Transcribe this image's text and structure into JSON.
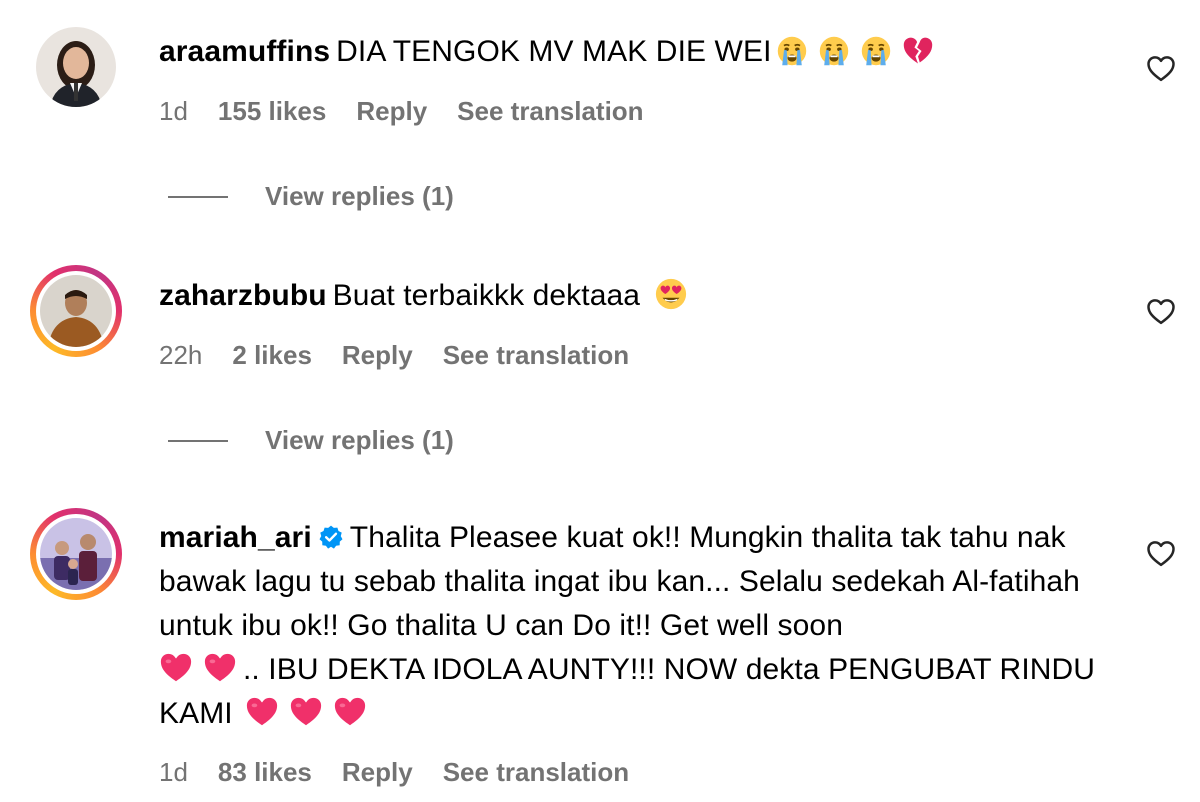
{
  "comments": [
    {
      "username": "araamuffins",
      "text": "DIA TENGOK MV MAK DIE WEI",
      "time": "1d",
      "likes": "155 likes",
      "reply": "Reply",
      "translation": "See translation",
      "view_replies": "View replies (1)",
      "emojis": [
        "crying-face",
        "crying-face",
        "crying-face",
        "broken-heart"
      ]
    },
    {
      "username": "zaharzbubu",
      "text": "Buat terbaikkk dektaaa",
      "time": "22h",
      "likes": "2 likes",
      "reply": "Reply",
      "translation": "See translation",
      "view_replies": "View replies (1)",
      "emojis": [
        "heart-eyes-face"
      ]
    },
    {
      "username": "mariah_ari",
      "verified": true,
      "text_part1": "Thalita Pleasee kuat ok!! Mungkin thalita tak tahu nak bawak lagu tu sebab thalita ingat ibu kan... Selalu sedekah Al-fatihah untuk ibu ok!! Go thalita U can Do it!! Get well soon",
      "text_part2": ".. IBU DEKTA IDOLA AUNTY!!! NOW dekta PENGUBAT RINDU KAMI",
      "time": "1d",
      "likes": "83 likes",
      "reply": "Reply",
      "translation": "See translation",
      "emojis": [
        "pink-heart",
        "pink-heart",
        "pink-heart",
        "pink-heart",
        "pink-heart"
      ]
    }
  ],
  "colors": {
    "meta_gray": "#737373",
    "verified_blue": "#0095f6",
    "heart_pink": "#f0306a"
  }
}
